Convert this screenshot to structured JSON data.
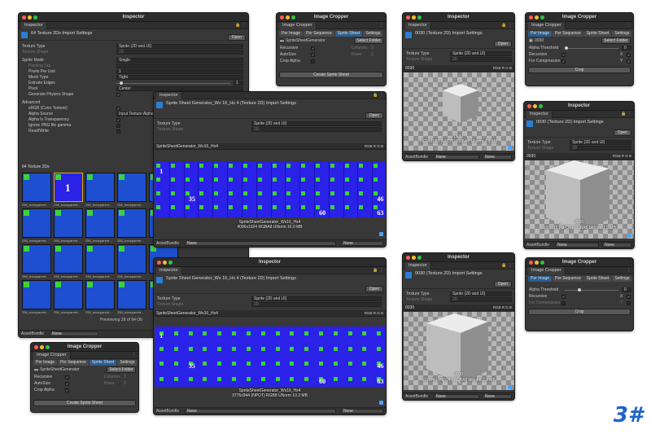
{
  "logo_text": "3#",
  "colors": {
    "window_bg": "#383838",
    "title_bg": "#2b2b2b",
    "sprite_blue": "#2a22e6",
    "tile_green": "#3bd23b",
    "accent": "#2c5d8f"
  },
  "inspector_main": {
    "title": "Inspector",
    "tab": "Inspector",
    "header": "64 Texture 2Ds Import Settings",
    "open": "Open",
    "texture_type": {
      "label": "Texture Type",
      "value": "Sprite (2D and UI)"
    },
    "texture_shape": {
      "label": "Texture Shape",
      "value": "2D"
    },
    "sprite_mode": {
      "label": "Sprite Mode",
      "value": "Single"
    },
    "packing_tag": {
      "label": "Packing Tag"
    },
    "pixels_per_unit": {
      "label": "Pixels Per Unit",
      "value": "1"
    },
    "mesh_type": {
      "label": "Mesh Type",
      "value": "Tight"
    },
    "extrude_edges": {
      "label": "Extrude Edges",
      "value": "1"
    },
    "pivot": {
      "label": "Pivot",
      "value": "Center"
    },
    "gen_physics": {
      "label": "Generate Physics Shape"
    },
    "advanced": "Advanced",
    "srgb": {
      "label": "sRGB (Color Texture)"
    },
    "alpha_source": {
      "label": "Alpha Source",
      "value": "Input Texture Alpha"
    },
    "alpha_transparency": {
      "label": "Alpha Is Transparency"
    },
    "ignore_png": {
      "label": "Ignore PNG file gamma"
    },
    "read_write": {
      "label": "Read/Write"
    },
    "list_header": "64 Texture 2Ds",
    "tile_name": "256_transparent...",
    "tile_label_1": "1",
    "previewing": "Previewing 28 of 64 Ob",
    "assetbundle": "AssetBundle",
    "assetbundle_value": "None"
  },
  "cropper_top": {
    "title": "Image Cropper",
    "tab": "Image Cropper",
    "subtabs": [
      "Per Image",
      "Per Sequence",
      "Sprite Sheet",
      "Settings"
    ],
    "asset": "SpriteSheetGenerator",
    "select_folder": "Select Folder",
    "recursive": "Recursive",
    "autosize": "AutoSize",
    "crop_alpha": "Crop Alpha",
    "columns_label": "Columns",
    "columns_value": "2",
    "rows_label": "Rows",
    "rows_value": "2",
    "create": "Create Sprite Sheet"
  },
  "inspector_sheet_16x4": {
    "tab": "Inspector",
    "header": "Sprite Sheet Generator_Wx 16_Hx 4 (Texture 2D) Import Settings",
    "open": "Open",
    "texture_type": {
      "label": "Texture Type",
      "value": "Sprite (2D and UI)"
    },
    "texture_shape": {
      "label": "Texture Shape",
      "value": "2D"
    },
    "rgb_name": "SpriteSheetGenerator_Wx16_Hx4",
    "rgb": "RGB",
    "nums": [
      "1",
      "35",
      "46",
      "60",
      "63"
    ],
    "name": "SpriteSheetGenerator_Wx16_Hx4",
    "info": "4096x1024  RGBA8 UNorm  16.0 MB",
    "assetbundle": "AssetBundle",
    "none1": "None",
    "none2": "None"
  },
  "inspector_sheet_bottom": {
    "title": "Inspector",
    "tab": "Inspector",
    "header": "Sprite Sheet Generator_Wx 16_Hx 4 (Texture 2D) Import Settings",
    "open": "Open",
    "texture_type": {
      "label": "Texture Type",
      "value": "Sprite (2D and UI)"
    },
    "texture_shape": {
      "label": "Texture Shape",
      "value": "2D"
    },
    "rgb_name": "SpriteSheetGenerator_Wx16_Hx4",
    "rgb": "RGB",
    "nums": [
      "1",
      "35",
      "46",
      "60",
      "63"
    ],
    "name": "SpriteSheetGenerator_Wx16_Hx4",
    "info": "3776x944 (NPOT)  RGB8 UNorm  10.2 MB",
    "assetbundle": "AssetBundle",
    "none1": "None",
    "none2": "None"
  },
  "cropper_bottom": {
    "title": "Image Cropper",
    "tab": "Image Cropper",
    "subtabs": [
      "Per Image",
      "Per Sequence",
      "Sprite Sheet",
      "Settings"
    ],
    "asset": "SpriteSheetGenerator",
    "select_folder": "Select Folder",
    "recursive": "Recursive",
    "autosize": "AutoSize",
    "crop_alpha": "Crop Alpha",
    "columns_label": "Columns",
    "columns_value": "3",
    "rows_label": "Rows",
    "rows_value": "3",
    "create": "Create Sprite Sheet"
  },
  "inspector_cube_a": {
    "title": "Inspector",
    "tab": "Inspector",
    "header": "0030 (Texture 2D) Import Settings",
    "open": "Open",
    "texture_type": {
      "label": "Texture Type",
      "value": "Sprite (2D and UI)"
    },
    "texture_shape": {
      "label": "Texture Shape",
      "value": "2D"
    },
    "rgb_name": "0030",
    "rgb": "RGB",
    "name": "0030",
    "info": "1920x1080 (NPOT)  RGBA8 UNorm  7.9 MB",
    "assetbundle": "AssetBundle",
    "none1": "None",
    "none2": "None"
  },
  "cropper_right_top": {
    "title": "Image Cropper",
    "tab": "Image Cropper",
    "subtabs": [
      "Per Image",
      "Per Sequence",
      "Sprite Sheet",
      "Settings"
    ],
    "asset": "0030",
    "select_folder": "Select Folder",
    "alpha_threshold": "Alpha Threshold",
    "alpha_value": "0",
    "recursive": "Recursive",
    "for_compression": "For Compression",
    "x": "X",
    "y": "Y",
    "crop": "Crop"
  },
  "inspector_cube_b": {
    "title": "Inspector",
    "tab": "Inspector",
    "header": "0030 (Texture 2D) Import Settings",
    "open": "Open",
    "texture_type": {
      "label": "Texture Type",
      "value": "Sprite (2D and UI)"
    },
    "texture_shape": {
      "label": "Texture Shape",
      "value": "2D"
    },
    "rgb_name": "0030",
    "rgb": "RGB",
    "name": "0030",
    "info": "690x718 (NPOT)  RGBA8 UNorm  1.9 MB",
    "assetbundle": "AssetBundle",
    "none1": "None",
    "none2": "None"
  },
  "inspector_cube_c": {
    "title": "Inspector",
    "tab": "Inspector",
    "header": "0030 (Texture 2D) Import Settings",
    "open": "Open",
    "texture_type": {
      "label": "Texture Type",
      "value": "Sprite (2D and UI)"
    },
    "texture_shape": {
      "label": "Texture Shape",
      "value": "2D"
    },
    "rgb_name": "0030",
    "rgb": "RGB",
    "name": "0030",
    "info": "692x740 (NPOT)  RGBA8 UNorm  2.0 MB",
    "assetbundle": "AssetBundle",
    "none1": "None",
    "none2": "None"
  },
  "cropper_right_bottom": {
    "title": "Image Cropper",
    "tab": "Image Cropper",
    "subtabs": [
      "Per Image",
      "Per Sequence",
      "Sprite Sheet",
      "Settings"
    ],
    "alpha_threshold": "Alpha Threshold",
    "alpha_value": "0",
    "recursive": "Recursive",
    "for_compression": "For Compression",
    "x": "X",
    "y": "Y",
    "crop": "Crop"
  }
}
